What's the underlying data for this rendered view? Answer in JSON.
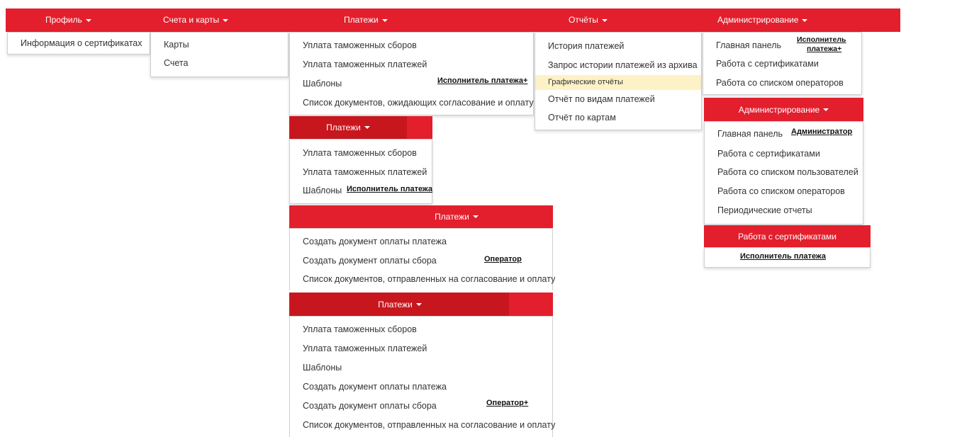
{
  "colors": {
    "brand_red": "#e31e2d",
    "dark_red": "#c8161e",
    "highlight": "#fdf2c7"
  },
  "top_nav": {
    "profile": "Профиль",
    "accounts": "Счета и карты",
    "payments": "Платежи",
    "reports": "Отчёты",
    "admin": "Администрирование"
  },
  "profile_menu": [
    "Информация о сертификатах"
  ],
  "accounts_menu": [
    "Карты",
    "Счета"
  ],
  "payments_menu_1": {
    "items": [
      "Уплата таможенных сборов",
      "Уплата таможенных платежей",
      "Шаблоны",
      "Список документов, ожидающих согласование и оплату"
    ],
    "role": "Исполнитель платежа+"
  },
  "reports_menu": {
    "items": [
      "История платежей",
      "Запрос истории платежей из архива",
      "Графические отчёты",
      "Отчёт по видам платежей",
      "Отчёт по картам"
    ],
    "selected": "Графические отчёты"
  },
  "admin_menu_1": {
    "items": [
      "Главная панель",
      "Работа с сертификатами",
      "Работа со списком операторов"
    ],
    "role_line1": "Исполнитель",
    "role_line2": "платежа+"
  },
  "payments_variant_2": {
    "title": "Платежи",
    "items": [
      "Уплата таможенных сборов",
      "Уплата таможенных платежей",
      "Шаблоны"
    ],
    "role": "Исполнитель платежа"
  },
  "payments_variant_3": {
    "title": "Платежи",
    "items": [
      "Создать документ оплаты платежа",
      "Создать документ оплаты сбора",
      "Список документов, отправленных на согласование и оплату"
    ],
    "role": "Оператор"
  },
  "payments_variant_4": {
    "title": "Платежи",
    "items": [
      "Уплата таможенных сборов",
      "Уплата таможенных платежей",
      "Шаблоны",
      "Создать документ оплаты платежа",
      "Создать документ оплаты сбора",
      "Список документов, отправленных на согласование и оплату"
    ],
    "role": "Оператор+"
  },
  "admin_variant_2": {
    "title": "Администрирование",
    "items": [
      "Главная панель",
      "Работа с сертификатами",
      "Работа со списком пользователей",
      "Работа со списком операторов",
      "Периодические отчеты"
    ],
    "role": "Администратор"
  },
  "cert_variant": {
    "title": "Работа с сертификатами",
    "role": "Исполнитель платежа"
  }
}
